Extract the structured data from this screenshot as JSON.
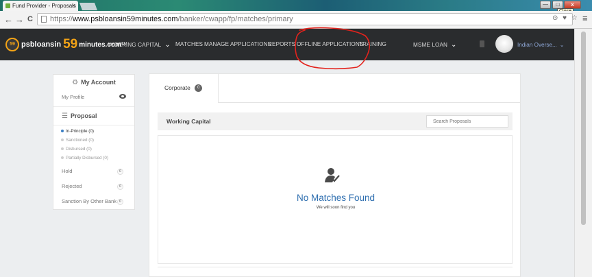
{
  "browser": {
    "tab_title": "Fund Provider - Proposals",
    "tab_close": "×",
    "url_scheme": "https://",
    "url_host": "www.psbloansin59minutes.com",
    "url_path": "/banker/cwapp/fp/matches/primary",
    "close_tooltip": "Close",
    "back": "←",
    "forward": "→",
    "reload": "C",
    "extensions": "⊙ ♥ ☆",
    "menu": "≡",
    "minimize": "—",
    "maximize": "□",
    "close": "x"
  },
  "header": {
    "logo": {
      "badge": "59",
      "brand_prefix": "psbloansin",
      "brand_number": "59",
      "brand_suffix": "minutes.com",
      "trademark": "TM"
    },
    "nav": {
      "working_capital": "WORKING CAPITAL",
      "matches": "MATCHES",
      "manage_applications": "MANAGE APPLICATIONS",
      "reports": "REPORTS",
      "offline_applications": "OFFLINE APPLICATIONS",
      "training": "TRAINING",
      "msme_loan": "MSME LOAN"
    },
    "chevron": "❯",
    "user_name": "Indian Overse...",
    "annotation_color": "#e3231d"
  },
  "sidebar": {
    "account_icon": "⚙",
    "account_title": "My Account",
    "my_profile": "My Profile",
    "proposal_icon": "☰",
    "proposal_title": "Proposal",
    "proposal_items": [
      {
        "label": "In-Principle (0)",
        "active": true
      },
      {
        "label": "Sanctioned (0)",
        "active": false
      },
      {
        "label": "Disbursed (0)",
        "active": false
      },
      {
        "label": "Partially Disbursed (0)",
        "active": false
      }
    ],
    "hold": {
      "label": "Hold",
      "count": "0"
    },
    "rejected": {
      "label": "Rejected",
      "count": "0"
    },
    "sanction_other": {
      "label": "Sanction By Other Bank",
      "count": "0"
    }
  },
  "main": {
    "tab_corporate": "Corporate",
    "tab_corporate_count": "0",
    "section_title": "Working Capital",
    "search_placeholder": "Search Proposals",
    "empty_title": "No Matches Found",
    "empty_subtitle": "We will soon find you"
  },
  "colors": {
    "header_bg": "#2a2c2e",
    "brand_orange": "#f3a316",
    "link_blue": "#2f6fb0",
    "annotation_red": "#e3231d"
  }
}
